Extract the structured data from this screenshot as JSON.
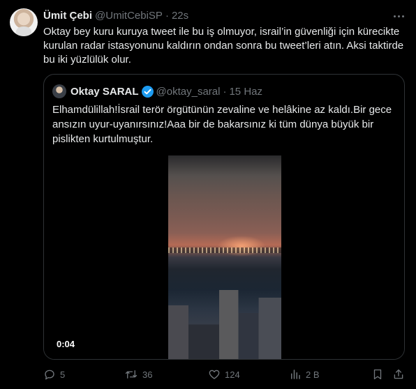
{
  "tweet": {
    "author_name": "Ümit Çebi",
    "author_handle": "@UmitCebiSP",
    "separator": "·",
    "time": "22s",
    "text": "Oktay bey kuru kuruya tweet ile bu iş olmuyor, israil’in güvenliği için kürecikte kurulan radar istasyonunu kaldırın ondan sonra bu tweet’leri atın. Aksi taktirde bu iki yüzlülük olur."
  },
  "quote": {
    "author_name": "Oktay SARAL",
    "author_handle": "@oktay_saral",
    "separator": "·",
    "date": "15 Haz",
    "text": "Elhamdülillah!İsrail terör örgütünün zevaline ve helâkine az kaldı.Bir gece ansızın uyur-uyanırsınız!Aaa bir de bakarsınız ki tüm dünya büyük bir pislikten kurtulmuştur.",
    "video_duration": "0:04"
  },
  "actions": {
    "replies": "5",
    "reposts": "36",
    "likes": "124",
    "views": "2 B"
  },
  "icons": {
    "reply": "reply-icon",
    "repost": "repost-icon",
    "like": "heart-icon",
    "views": "views-icon",
    "bookmark": "bookmark-icon",
    "share": "share-icon",
    "more": "more-icon",
    "verified": "verified-badge-icon"
  },
  "colors": {
    "background": "#000000",
    "text": "#e7e9ea",
    "muted": "#71767b",
    "border": "#2f3336",
    "verified": "#1d9bf0"
  }
}
